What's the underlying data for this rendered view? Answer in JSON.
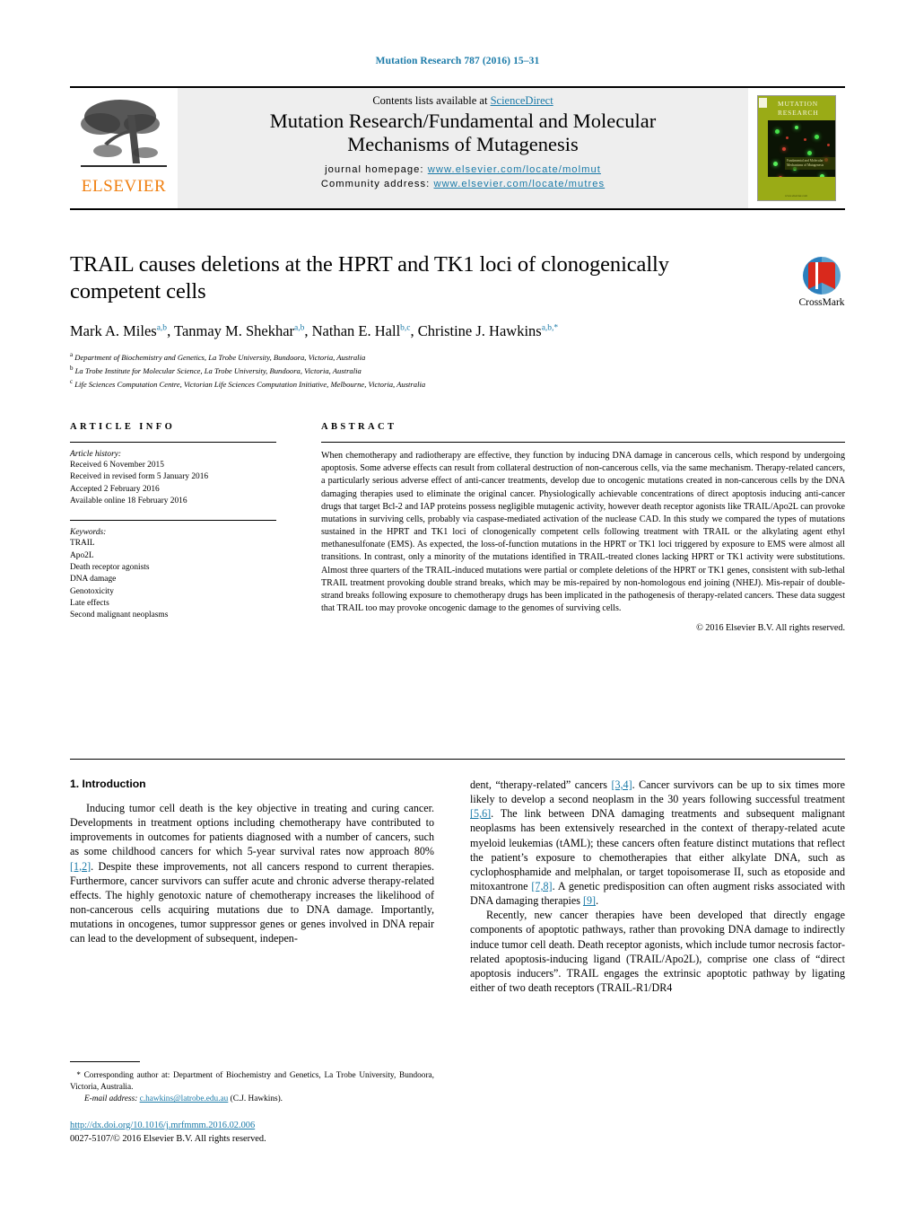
{
  "running_head": "Mutation Research 787 (2016) 15–31",
  "masthead": {
    "publisher_logo_text": "ELSEVIER",
    "contents_prefix": "Contents lists available at ",
    "contents_link": "ScienceDirect",
    "journal_title_line1": "Mutation Research/Fundamental and Molecular",
    "journal_title_line2": "Mechanisms of Mutagenesis",
    "homepage_label": "journal homepage:",
    "homepage_url": "www.elsevier.com/locate/molmut",
    "community_label": "Community address:",
    "community_url": "www.elsevier.com/locate/mutres",
    "cover": {
      "title_line1": "MUTATION",
      "title_line2": "RESEARCH",
      "subtitle": "Fundamental and Molecular Mechanisms of Mutagenesis",
      "footer": "www.elsevier.com"
    }
  },
  "article": {
    "title": "TRAIL causes deletions at the HPRT and TK1 loci of clonogenically competent cells",
    "authors": [
      {
        "name": "Mark A. Miles",
        "marks": "a,b",
        "sep": ", "
      },
      {
        "name": "Tanmay M. Shekhar",
        "marks": "a,b",
        "sep": ", "
      },
      {
        "name": "Nathan E. Hall",
        "marks": "b,c",
        "sep": ", "
      },
      {
        "name": "Christine J. Hawkins",
        "marks": "a,b,*",
        "sep": ""
      }
    ],
    "affiliations": [
      {
        "mark": "a",
        "text": "Department of Biochemistry and Genetics, La Trobe University, Bundoora, Victoria, Australia"
      },
      {
        "mark": "b",
        "text": "La Trobe Institute for Molecular Science, La Trobe University, Bundoora, Victoria, Australia"
      },
      {
        "mark": "c",
        "text": "Life Sciences Computation Centre, Victorian Life Sciences Computation Initiative, Melbourne, Victoria, Australia"
      }
    ],
    "crossmark_label": "CrossMark"
  },
  "article_info": {
    "heading": "ARTICLE INFO",
    "history_label": "Article history:",
    "history": [
      "Received 6 November 2015",
      "Received in revised form 5 January 2016",
      "Accepted 2 February 2016",
      "Available online 18 February 2016"
    ],
    "keywords_label": "Keywords:",
    "keywords": [
      "TRAIL",
      "Apo2L",
      "Death receptor agonists",
      "DNA damage",
      "Genotoxicity",
      "Late effects",
      "Second malignant neoplasms"
    ]
  },
  "abstract": {
    "heading": "ABSTRACT",
    "text": "When chemotherapy and radiotherapy are effective, they function by inducing DNA damage in cancerous cells, which respond by undergoing apoptosis. Some adverse effects can result from collateral destruction of non-cancerous cells, via the same mechanism. Therapy-related cancers, a particularly serious adverse effect of anti-cancer treatments, develop due to oncogenic mutations created in non-cancerous cells by the DNA damaging therapies used to eliminate the original cancer. Physiologically achievable concentrations of direct apoptosis inducing anti-cancer drugs that target Bcl-2 and IAP proteins possess negligible mutagenic activity, however death receptor agonists like TRAIL/Apo2L can provoke mutations in surviving cells, probably via caspase-mediated activation of the nuclease CAD. In this study we compared the types of mutations sustained in the HPRT and TK1 loci of clonogenically competent cells following treatment with TRAIL or the alkylating agent ethyl methanesulfonate (EMS). As expected, the loss-of-function mutations in the HPRT or TK1 loci triggered by exposure to EMS were almost all transitions. In contrast, only a minority of the mutations identified in TRAIL-treated clones lacking HPRT or TK1 activity were substitutions. Almost three quarters of the TRAIL-induced mutations were partial or complete deletions of the HPRT or TK1 genes, consistent with sub-lethal TRAIL treatment provoking double strand breaks, which may be mis-repaired by non-homologous end joining (NHEJ). Mis-repair of double-strand breaks following exposure to chemotherapy drugs has been implicated in the pathogenesis of therapy-related cancers. These data suggest that TRAIL too may provoke oncogenic damage to the genomes of surviving cells.",
    "copyright": "© 2016 Elsevier B.V. All rights reserved."
  },
  "body": {
    "section_number_title": "1. Introduction",
    "left_paragraph_1a": "Inducing tumor cell death is the key objective in treating and curing cancer. Developments in treatment options including chemotherapy have contributed to improvements in outcomes for patients diagnosed with a number of cancers, such as some childhood cancers for which 5-year survival rates now approach 80% ",
    "ref_1_2": "[1,2]",
    "left_paragraph_1b": ". Despite these improvements, not all cancers respond to current therapies. Furthermore, cancer survivors can suffer acute and chronic adverse therapy-related effects. The highly genotoxic nature of chemotherapy increases the likelihood of non-cancerous cells acquiring mutations due to DNA damage. Importantly, mutations in oncogenes, tumor suppressor genes or genes involved in DNA repair can lead to the development of subsequent, indepen-",
    "right_paragraph_1c": "dent, “therapy-related” cancers ",
    "ref_3_4": "[3,4]",
    "right_paragraph_1d": ". Cancer survivors can be up to six times more likely to develop a second neoplasm in the 30 years following successful treatment ",
    "ref_5_6": "[5,6]",
    "right_paragraph_1e": ". The link between DNA damaging treatments and subsequent malignant neoplasms has been extensively researched in the context of therapy-related acute myeloid leukemias (tAML); these cancers often feature distinct mutations that reflect the patient’s exposure to chemotherapies that either alkylate DNA, such as cyclophosphamide and melphalan, or target topoisomerase II, such as etoposide and mitoxantrone ",
    "ref_7_8": "[7,8]",
    "right_paragraph_1f": ". A genetic predisposition can often augment risks associated with DNA damaging therapies ",
    "ref_9": "[9]",
    "right_paragraph_1g": ".",
    "right_paragraph_2": "Recently, new cancer therapies have been developed that directly engage components of apoptotic pathways, rather than provoking DNA damage to indirectly induce tumor cell death. Death receptor agonists, which include tumor necrosis factor-related apoptosis-inducing ligand (TRAIL/Apo2L), comprise one class of “direct apoptosis inducers”. TRAIL engages the extrinsic apoptotic pathway by ligating either of two death receptors (TRAIL-R1/DR4"
  },
  "footnotes": {
    "corresponding_marker": "*",
    "corresponding_text": "Corresponding author at: Department of Biochemistry and Genetics, La Trobe University, Bundoora, Victoria, Australia.",
    "email_label": "E-mail address:",
    "email": "c.hawkins@latrobe.edu.au",
    "email_suffix": "(C.J. Hawkins).",
    "doi": "http://dx.doi.org/10.1016/j.mrfmmm.2016.02.006",
    "issn_line": "0027-5107/© 2016 Elsevier B.V. All rights reserved."
  },
  "colors": {
    "link": "#1a7aa8",
    "elsevier_orange": "#F07F10",
    "cover_green": "#9aab16"
  }
}
